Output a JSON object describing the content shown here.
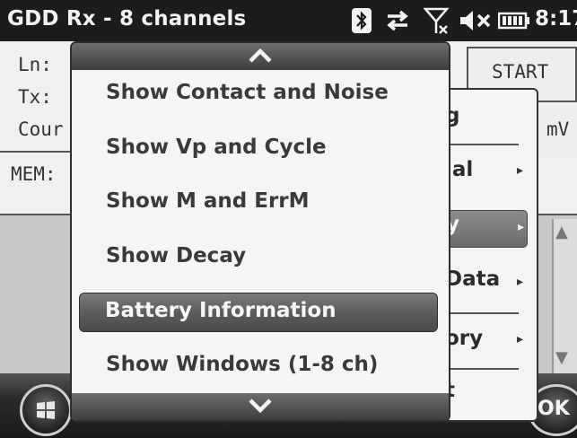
{
  "titlebar": {
    "title": "GDD Rx - 8 channels",
    "time": "8:17",
    "icons": [
      "bluetooth-icon",
      "data-sync-icon",
      "no-signal-icon",
      "volume-muted-icon",
      "battery-icon"
    ]
  },
  "background": {
    "labels": [
      "Ln:",
      "Tx:",
      "Cour",
      "MEM:"
    ],
    "start_label": "START",
    "unit_label": "mV"
  },
  "submenu": {
    "items": [
      {
        "label": "g",
        "arrow": ""
      },
      {
        "label": "ial",
        "arrow": "▸"
      },
      {
        "label": "y",
        "arrow": "▸"
      },
      {
        "label": "Data",
        "arrow": "▸"
      },
      {
        "label": "ory",
        "arrow": "▸"
      },
      {
        "label": "t",
        "arrow": ""
      }
    ],
    "highlighted_index": 2
  },
  "popup": {
    "items": [
      "Show Contact and Noise",
      "Show Vp and Cycle",
      "Show M and ErrM",
      "Show Decay",
      "Battery Information",
      "Show Windows (1-8 ch)"
    ],
    "highlighted_index": 4
  },
  "softkeys": {
    "ok_label": "OK"
  },
  "colors": {
    "titlebar_bg": "#1c1c1c",
    "highlight": "#5a5a5a",
    "menu_bg": "#f5f5f5"
  }
}
